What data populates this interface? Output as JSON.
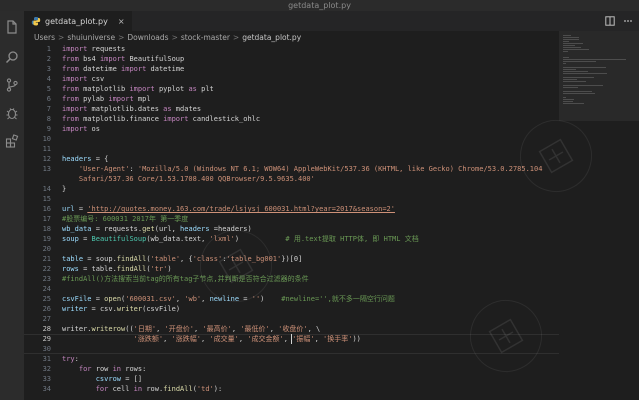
{
  "window": {
    "title": "getdata_plot.py"
  },
  "activity_bar": {
    "icons": [
      "files-icon",
      "search-icon",
      "source-control-icon",
      "debug-icon",
      "extensions-icon"
    ]
  },
  "tab": {
    "label": "getdata_plot.py",
    "close": "×"
  },
  "breadcrumb": {
    "parts": [
      "Users",
      "shuiuniverse",
      "Downloads",
      "stock-master"
    ],
    "separator": ">",
    "file": "getdata_plot.py"
  },
  "editor": {
    "lines": [
      {
        "n": "1",
        "t": [
          [
            "kw",
            "import"
          ],
          [
            "plain",
            " requests"
          ]
        ]
      },
      {
        "n": "2",
        "t": [
          [
            "kw",
            "from"
          ],
          [
            "plain",
            " bs4 "
          ],
          [
            "kw",
            "import"
          ],
          [
            "plain",
            " BeautifulSoup"
          ]
        ]
      },
      {
        "n": "3",
        "t": [
          [
            "kw",
            "from"
          ],
          [
            "plain",
            " datetime "
          ],
          [
            "kw",
            "import"
          ],
          [
            "plain",
            " datetime"
          ]
        ]
      },
      {
        "n": "4",
        "t": [
          [
            "kw",
            "import"
          ],
          [
            "plain",
            " csv"
          ]
        ]
      },
      {
        "n": "5",
        "t": [
          [
            "kw",
            "from"
          ],
          [
            "plain",
            " matplotlib "
          ],
          [
            "kw",
            "import"
          ],
          [
            "plain",
            " pyplot "
          ],
          [
            "kw",
            "as"
          ],
          [
            "plain",
            " plt"
          ]
        ]
      },
      {
        "n": "6",
        "t": [
          [
            "kw",
            "from"
          ],
          [
            "plain",
            " pylab "
          ],
          [
            "kw",
            "import"
          ],
          [
            "plain",
            " mpl"
          ]
        ]
      },
      {
        "n": "7",
        "t": [
          [
            "kw",
            "import"
          ],
          [
            "plain",
            " matplotlib.dates "
          ],
          [
            "kw",
            "as"
          ],
          [
            "plain",
            " mdates"
          ]
        ]
      },
      {
        "n": "8",
        "t": [
          [
            "kw",
            "from"
          ],
          [
            "plain",
            " matplotlib.finance "
          ],
          [
            "kw",
            "import"
          ],
          [
            "plain",
            " candlestick_ohlc"
          ]
        ]
      },
      {
        "n": "9",
        "t": [
          [
            "kw",
            "import"
          ],
          [
            "plain",
            " os"
          ]
        ]
      },
      {
        "n": "10",
        "t": []
      },
      {
        "n": "11",
        "t": []
      },
      {
        "n": "12",
        "t": [
          [
            "var",
            "headers"
          ],
          [
            "plain",
            " = {"
          ]
        ]
      },
      {
        "n": "13",
        "t": [
          [
            "plain",
            "    "
          ],
          [
            "str",
            "'User-Agent'"
          ],
          [
            "plain",
            ": "
          ],
          [
            "str",
            "'Mozilla/5.0 (Windows NT 6.1; WOW64) AppleWebKit/537.36 (KHTML, like Gecko) Chrome/53.0.2785.104"
          ]
        ]
      },
      {
        "n": "",
        "t": [
          [
            "str",
            "    Safari/537.36 Core/1.53.1708.400 QQBrowser/9.5.9635.400'"
          ]
        ]
      },
      {
        "n": "14",
        "t": [
          [
            "plain",
            "}"
          ]
        ]
      },
      {
        "n": "15",
        "t": []
      },
      {
        "n": "16",
        "t": [
          [
            "var",
            "url"
          ],
          [
            "plain",
            " = "
          ],
          [
            "url",
            "'http://quotes.money.163.com/trade/lsjysj_600031.html?year=2017&season=2'"
          ]
        ]
      },
      {
        "n": "17",
        "t": [
          [
            "cm",
            "#股票编号: 600031 2017年 第一季度"
          ]
        ]
      },
      {
        "n": "18",
        "t": [
          [
            "var",
            "wb_data"
          ],
          [
            "plain",
            " = requests."
          ],
          [
            "fn",
            "get"
          ],
          [
            "plain",
            "(url, "
          ],
          [
            "var",
            "headers"
          ],
          [
            "plain",
            " =headers)"
          ]
        ]
      },
      {
        "n": "19",
        "t": [
          [
            "var",
            "soup"
          ],
          [
            "plain",
            " = "
          ],
          [
            "cls",
            "BeautifulSoup"
          ],
          [
            "plain",
            "(wb_data.text, "
          ],
          [
            "str",
            "'lxml'"
          ],
          [
            "plain",
            ")           "
          ],
          [
            "cm",
            "# 用.text提取 HTTP体, 即 HTML 文档"
          ]
        ]
      },
      {
        "n": "20",
        "t": []
      },
      {
        "n": "21",
        "t": [
          [
            "var",
            "table"
          ],
          [
            "plain",
            " = soup."
          ],
          [
            "fn",
            "findAll"
          ],
          [
            "plain",
            "("
          ],
          [
            "str",
            "'table'"
          ],
          [
            "plain",
            ", {"
          ],
          [
            "str",
            "'class'"
          ],
          [
            "plain",
            ":"
          ],
          [
            "str",
            "'table_bg001'"
          ],
          [
            "plain",
            "})[0]"
          ]
        ]
      },
      {
        "n": "22",
        "t": [
          [
            "var",
            "rows"
          ],
          [
            "plain",
            " = table."
          ],
          [
            "fn",
            "findAll"
          ],
          [
            "plain",
            "("
          ],
          [
            "str",
            "'tr'"
          ],
          [
            "plain",
            ")"
          ]
        ]
      },
      {
        "n": "23",
        "t": [
          [
            "cm",
            "#findAll()方法搜索当前tag的所有tag子节点,并判断是否符合过滤器的条件"
          ]
        ]
      },
      {
        "n": "24",
        "t": []
      },
      {
        "n": "25",
        "t": [
          [
            "var",
            "csvFile"
          ],
          [
            "plain",
            " = "
          ],
          [
            "fn",
            "open"
          ],
          [
            "plain",
            "("
          ],
          [
            "str",
            "'600031.csv'"
          ],
          [
            "plain",
            ", "
          ],
          [
            "str",
            "'wb'"
          ],
          [
            "plain",
            ", "
          ],
          [
            "var",
            "newline"
          ],
          [
            "plain",
            " = "
          ],
          [
            "str",
            "''"
          ],
          [
            "plain",
            ")    "
          ],
          [
            "cm",
            "#newline='',就不多一隔空行问题"
          ]
        ]
      },
      {
        "n": "26",
        "t": [
          [
            "var",
            "writer"
          ],
          [
            "plain",
            " = csv."
          ],
          [
            "fn",
            "writer"
          ],
          [
            "plain",
            "(csvFile)"
          ]
        ]
      },
      {
        "n": "27",
        "t": []
      },
      {
        "n": "28",
        "t": [
          [
            "plain",
            "writer."
          ],
          [
            "fn",
            "writerow"
          ],
          [
            "plain",
            "(("
          ],
          [
            "str",
            "'日期'"
          ],
          [
            "plain",
            ", "
          ],
          [
            "str",
            "'开盘价'"
          ],
          [
            "plain",
            ", "
          ],
          [
            "str",
            "'最高价'"
          ],
          [
            "plain",
            ", "
          ],
          [
            "str",
            "'最低价'"
          ],
          [
            "plain",
            ", "
          ],
          [
            "str",
            "'收盘价'"
          ],
          [
            "plain",
            ", \\"
          ]
        ]
      },
      {
        "n": "29",
        "t": [
          [
            "plain",
            "                 "
          ],
          [
            "str",
            "'涨跌额'"
          ],
          [
            "plain",
            ", "
          ],
          [
            "str",
            "'涨跌幅'"
          ],
          [
            "plain",
            ", "
          ],
          [
            "str",
            "'成交量'"
          ],
          [
            "plain",
            ", "
          ],
          [
            "str",
            "'成交金额'"
          ],
          [
            "plain",
            ", "
          ],
          [
            "str",
            "'振幅'"
          ],
          [
            "plain",
            ", "
          ],
          [
            "str",
            "'换手率'"
          ],
          [
            "plain",
            "))"
          ]
        ]
      },
      {
        "n": "30",
        "t": []
      },
      {
        "n": "31",
        "t": [
          [
            "kw",
            "try"
          ],
          [
            "plain",
            ":"
          ]
        ]
      },
      {
        "n": "32",
        "t": [
          [
            "plain",
            "    "
          ],
          [
            "kw",
            "for"
          ],
          [
            "plain",
            " row "
          ],
          [
            "kw",
            "in"
          ],
          [
            "plain",
            " rows:"
          ]
        ]
      },
      {
        "n": "33",
        "t": [
          [
            "plain",
            "        "
          ],
          [
            "var",
            "csvrow"
          ],
          [
            "plain",
            " = []"
          ]
        ]
      },
      {
        "n": "34",
        "t": [
          [
            "plain",
            "        "
          ],
          [
            "kw",
            "for"
          ],
          [
            "plain",
            " cell "
          ],
          [
            "kw",
            "in"
          ],
          [
            "plain",
            " row."
          ],
          [
            "fn",
            "findAll"
          ],
          [
            "plain",
            "("
          ],
          [
            "str",
            "'td'"
          ],
          [
            "plain",
            "):"
          ]
        ]
      }
    ]
  },
  "colors": {
    "background": "#1e1e1e",
    "keyword": "#c586c0",
    "string": "#ce9178",
    "comment": "#6a9955",
    "function": "#dcdcaa",
    "variable": "#9cdcfe",
    "class": "#4ec9b0"
  }
}
